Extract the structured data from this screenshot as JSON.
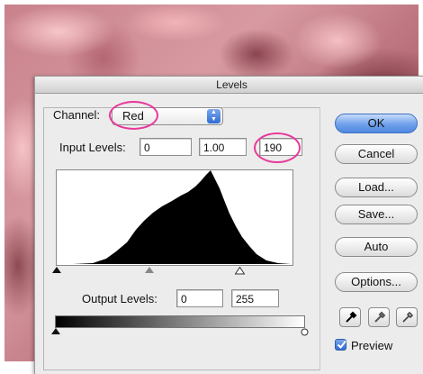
{
  "window": {
    "title": "Levels"
  },
  "channel": {
    "label": "Channel:",
    "selected": "Red"
  },
  "input_levels": {
    "label": "Input Levels:",
    "black": "0",
    "gamma": "1.00",
    "white": "190"
  },
  "output_levels": {
    "label": "Output Levels:",
    "black": "0",
    "white": "255"
  },
  "buttons": {
    "ok": "OK",
    "cancel": "Cancel",
    "load": "Load...",
    "save": "Save...",
    "auto": "Auto",
    "options": "Options..."
  },
  "preview": {
    "label": "Preview",
    "checked": true
  },
  "colors": {
    "highlight": "#e8389a",
    "accent": "#4f88e0"
  },
  "icons": [
    "eyedropper-black-icon",
    "eyedropper-gray-icon",
    "eyedropper-white-icon",
    "checkmark-icon"
  ]
}
